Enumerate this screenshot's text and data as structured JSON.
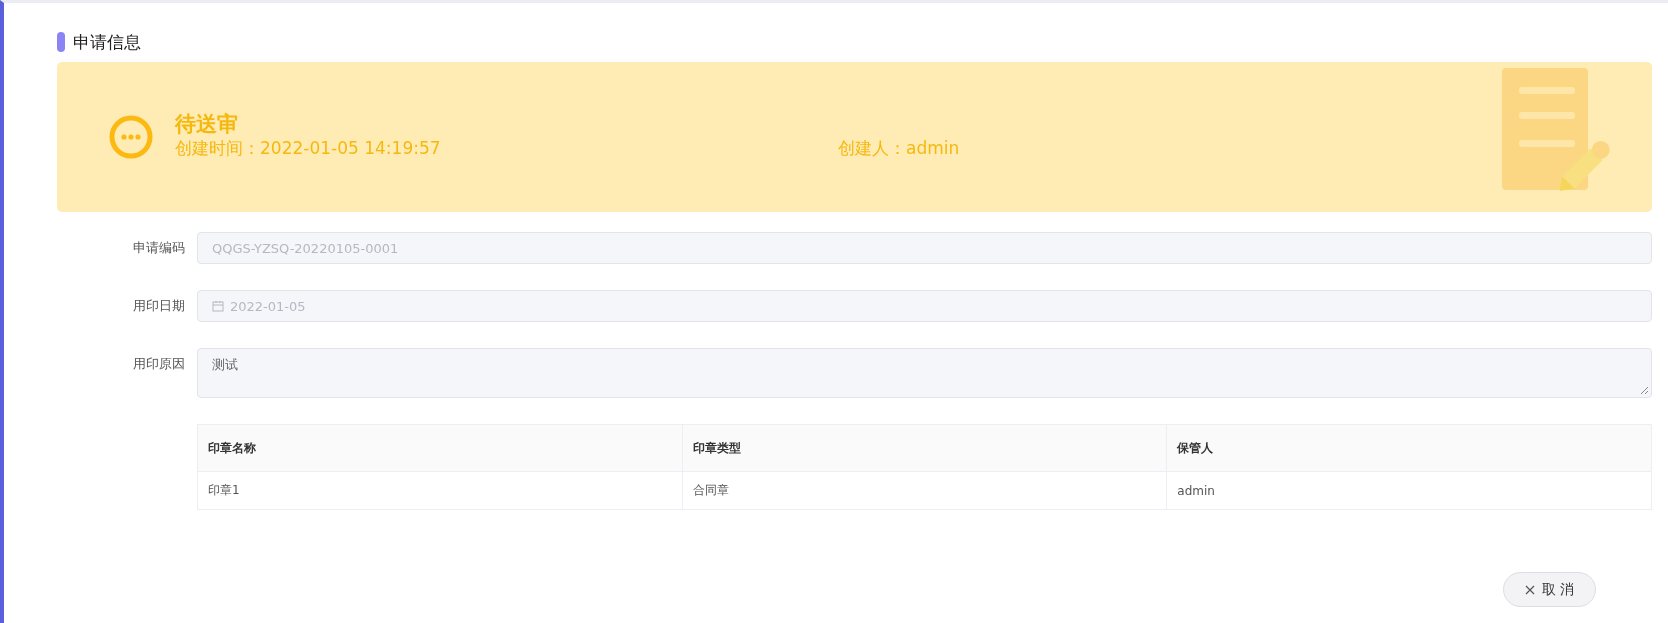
{
  "section": {
    "title": "申请信息"
  },
  "status_banner": {
    "status": "待送审",
    "created_time": "创建时间：2022-01-05 14:19:57",
    "creator": "创建人：admin"
  },
  "form": [
    {
      "kind": "text",
      "label": "申请编码",
      "value": "QQGS-YZSQ-20220105-0001",
      "disabled": true
    },
    {
      "kind": "date",
      "label": "用印日期",
      "value": "2022-01-05",
      "disabled": true
    },
    {
      "kind": "textarea",
      "label": "用印原因",
      "value": "测试"
    }
  ],
  "table": {
    "columns": [
      "印章名称",
      "印章类型",
      "保管人"
    ],
    "rows": [
      [
        "印章1",
        "合同章",
        "admin"
      ]
    ]
  },
  "buttons": [
    {
      "label": "取 消"
    }
  ]
}
